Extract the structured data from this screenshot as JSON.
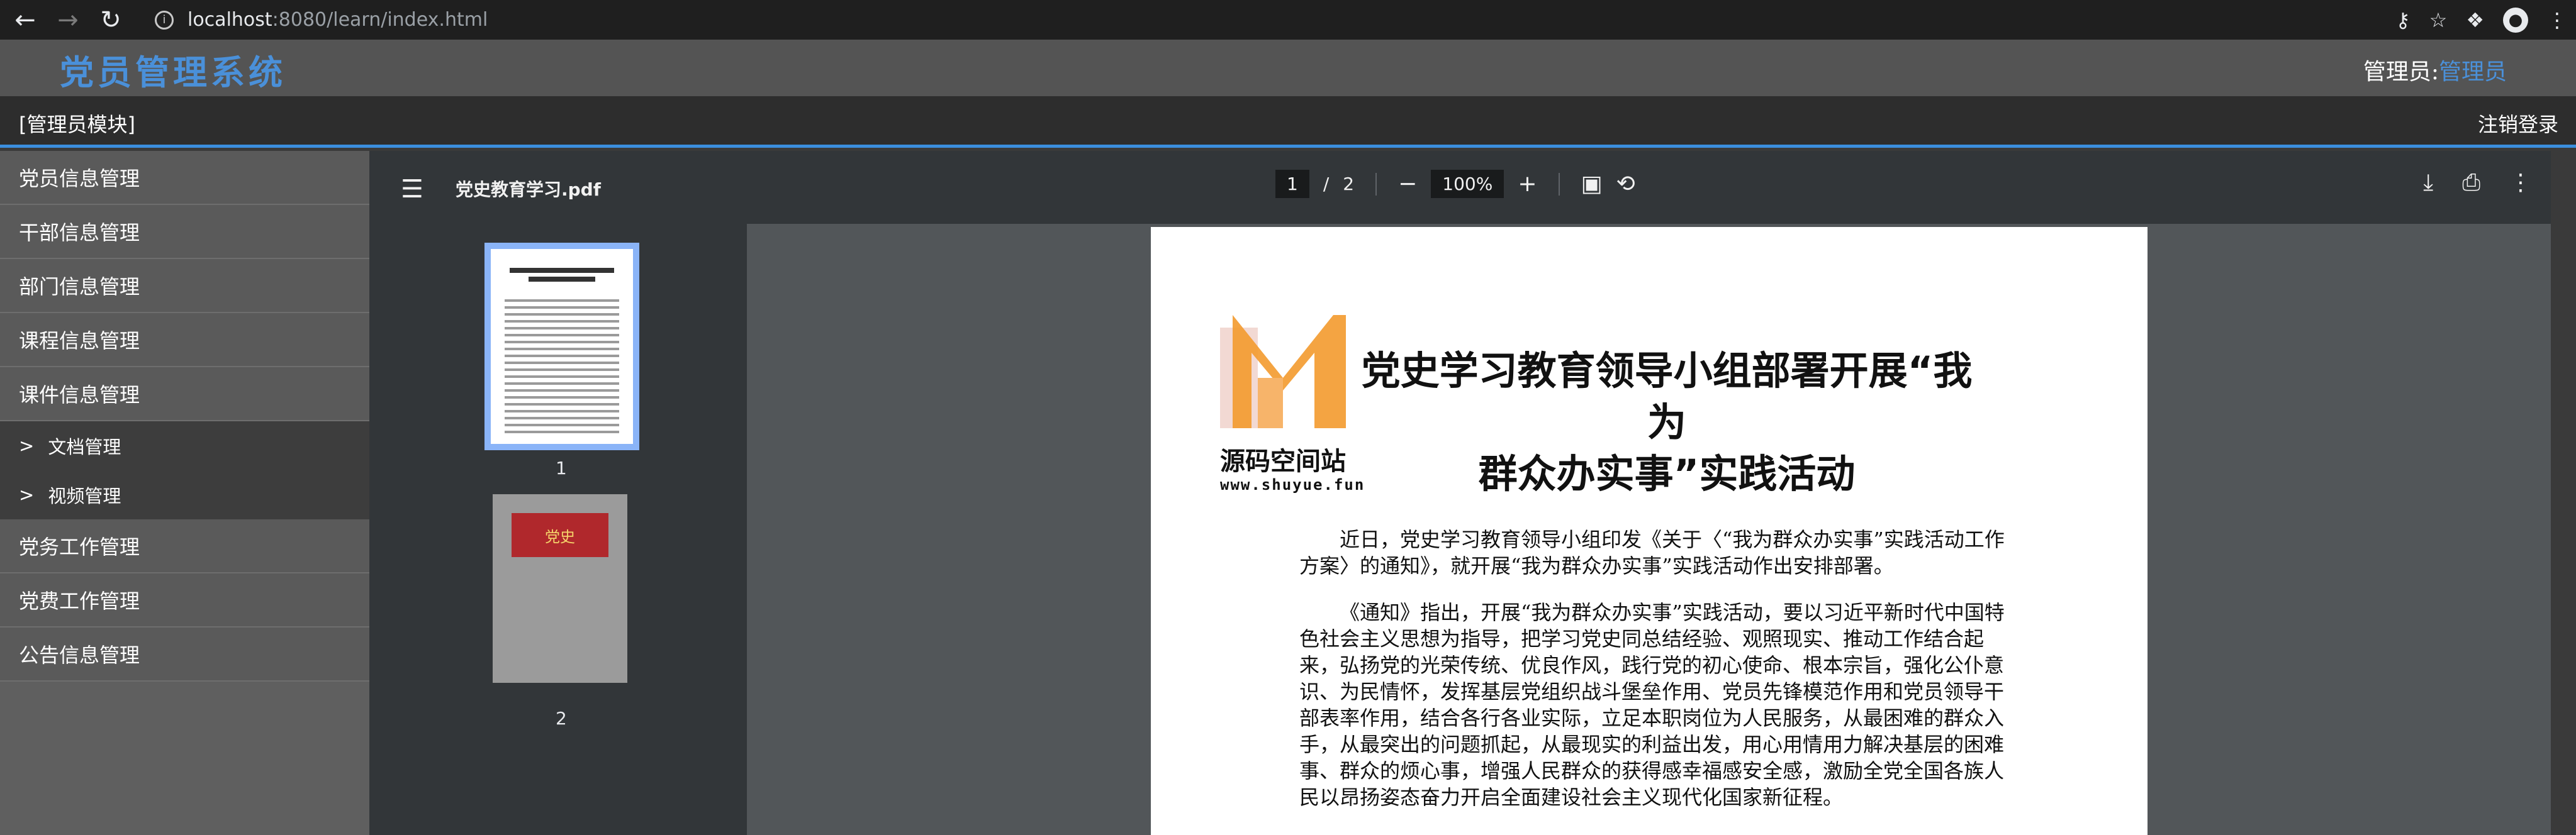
{
  "browser": {
    "url_host": "localhost",
    "url_rest": ":8080/learn/index.html"
  },
  "header": {
    "app_title": "党员管理系统",
    "admin_label": "管理员:",
    "admin_name": "管理员"
  },
  "module_bar": {
    "module_label": "[管理员模块]",
    "logout_label": "注销登录"
  },
  "sidebar": {
    "items": [
      {
        "label": "党员信息管理"
      },
      {
        "label": "干部信息管理"
      },
      {
        "label": "部门信息管理"
      },
      {
        "label": "课程信息管理"
      },
      {
        "label": "课件信息管理"
      }
    ],
    "subitems": [
      {
        "label": "文档管理"
      },
      {
        "label": "视频管理"
      }
    ],
    "items_after": [
      {
        "label": "党务工作管理"
      },
      {
        "label": "党费工作管理"
      },
      {
        "label": "公告信息管理"
      }
    ]
  },
  "pdf": {
    "file_name": "党史教育学习.pdf",
    "current_page": "1",
    "page_separator": "/",
    "total_pages": "2",
    "zoom": "100%",
    "thumb1_num": "1",
    "thumb2_num": "2",
    "thumb2_banner": "党史",
    "title_line1": "党史学习教育领导小组部署开展“我为",
    "title_line2": "群众办实事”实践活动",
    "para1": "近日，党史学习教育领导小组印发《关于〈“我为群众办实事”实践活动工作方案〉的通知》，就开展“我为群众办实事”实践活动作出安排部署。",
    "para2": "《通知》指出，开展“我为群众办实事”实践活动，要以习近平新时代中国特色社会主义思想为指导，把学习党史同总结经验、观照现实、推动工作结合起来，弘扬党的光荣传统、优良作风，践行党的初心使命、根本宗旨，强化公仆意识、为民情怀，发挥基层党组织战斗堡垒作用、党员先锋模范作用和党员领导干部表率作用，结合各行各业实际，立足本职岗位为人民服务，从最困难的群众入手，从最突出的问题抓起，从最现实的利益出发，用心用情用力解决基层的困难事、群众的烦心事，增强人民群众的获得感幸福感安全感，激励全党全国各族人民以昂扬姿态奋力开启全面建设社会主义现代化国家新征程。",
    "watermark_name": "源码空间站",
    "watermark_url": "www.shuyue.fun"
  },
  "colors": {
    "accent": "#4a90d9",
    "thumb_selected": "#8ab4f8"
  }
}
